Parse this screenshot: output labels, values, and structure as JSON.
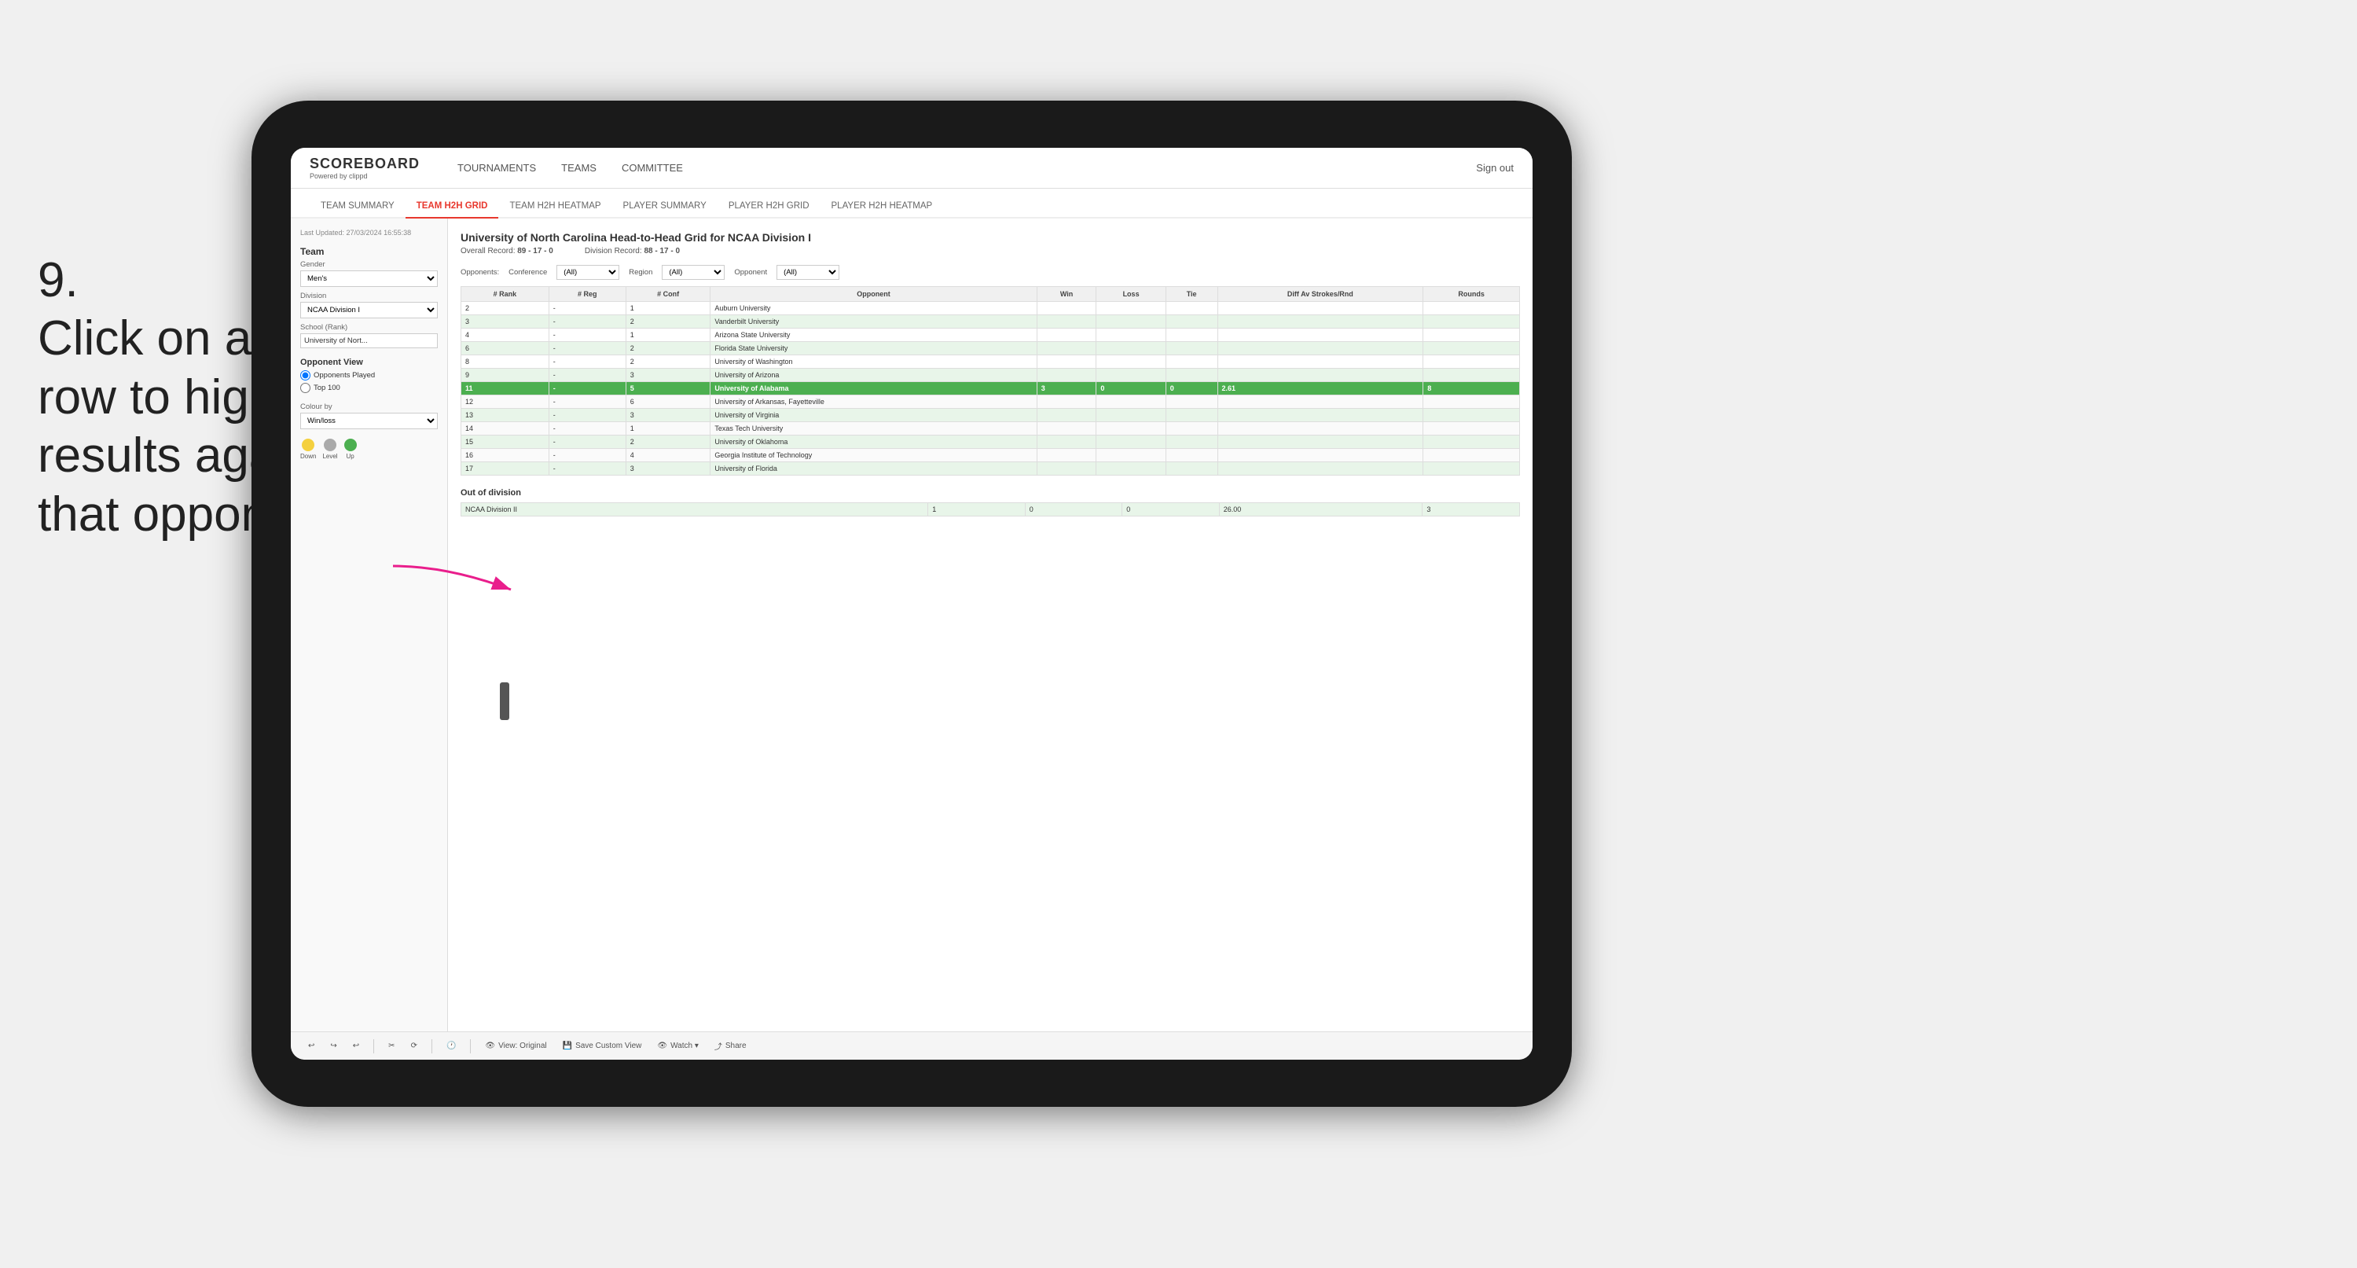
{
  "instruction": {
    "number": "9.",
    "text": "Click on a team's row to highlight results against that opponent"
  },
  "nav": {
    "logo": "SCOREBOARD",
    "logo_sub": "Powered by clippd",
    "links": [
      "TOURNAMENTS",
      "TEAMS",
      "COMMITTEE"
    ],
    "sign_out": "Sign out"
  },
  "tabs": [
    {
      "label": "TEAM SUMMARY",
      "active": false
    },
    {
      "label": "TEAM H2H GRID",
      "active": true
    },
    {
      "label": "TEAM H2H HEATMAP",
      "active": false
    },
    {
      "label": "PLAYER SUMMARY",
      "active": false
    },
    {
      "label": "PLAYER H2H GRID",
      "active": false
    },
    {
      "label": "PLAYER H2H HEATMAP",
      "active": false
    }
  ],
  "left_panel": {
    "last_updated": "Last Updated: 27/03/2024 16:55:38",
    "team_section": "Team",
    "gender_label": "Gender",
    "gender_value": "Men's",
    "division_label": "Division",
    "division_value": "NCAA Division I",
    "school_rank_label": "School (Rank)",
    "school_rank_value": "University of Nort...",
    "opponent_view_title": "Opponent View",
    "radio_1": "Opponents Played",
    "radio_2": "Top 100",
    "colour_by": "Colour by",
    "colour_value": "Win/loss",
    "dots": [
      {
        "color": "#f4d03f",
        "label": "Down"
      },
      {
        "color": "#aaa",
        "label": "Level"
      },
      {
        "color": "#4caf50",
        "label": "Up"
      }
    ]
  },
  "grid": {
    "title": "University of North Carolina Head-to-Head Grid for NCAA Division I",
    "overall_record_label": "Overall Record:",
    "overall_record_value": "89 - 17 - 0",
    "division_record_label": "Division Record:",
    "division_record_value": "88 - 17 - 0",
    "filter_opponents_label": "Opponents:",
    "filter_conf_label": "Conference",
    "filter_conf_value": "(All)",
    "filter_region_label": "Region",
    "filter_region_value": "(All)",
    "filter_opponent_label": "Opponent",
    "filter_opponent_value": "(All)",
    "table_headers": [
      "# Rank",
      "# Reg",
      "# Conf",
      "Opponent",
      "Win",
      "Loss",
      "Tie",
      "Diff Av Strokes/Rnd",
      "Rounds"
    ],
    "rows": [
      {
        "rank": "2",
        "reg": "-",
        "conf": "1",
        "opponent": "Auburn University",
        "win": "",
        "loss": "",
        "tie": "",
        "diff": "",
        "rounds": "",
        "highlight": false,
        "row_color": "none"
      },
      {
        "rank": "3",
        "reg": "-",
        "conf": "2",
        "opponent": "Vanderbilt University",
        "win": "",
        "loss": "",
        "tie": "",
        "diff": "",
        "rounds": "",
        "highlight": false,
        "row_color": "light_green"
      },
      {
        "rank": "4",
        "reg": "-",
        "conf": "1",
        "opponent": "Arizona State University",
        "win": "",
        "loss": "",
        "tie": "",
        "diff": "",
        "rounds": "",
        "highlight": false,
        "row_color": "none"
      },
      {
        "rank": "6",
        "reg": "-",
        "conf": "2",
        "opponent": "Florida State University",
        "win": "",
        "loss": "",
        "tie": "",
        "diff": "",
        "rounds": "",
        "highlight": false,
        "row_color": "light_green"
      },
      {
        "rank": "8",
        "reg": "-",
        "conf": "2",
        "opponent": "University of Washington",
        "win": "",
        "loss": "",
        "tie": "",
        "diff": "",
        "rounds": "",
        "highlight": false,
        "row_color": "none"
      },
      {
        "rank": "9",
        "reg": "-",
        "conf": "3",
        "opponent": "University of Arizona",
        "win": "",
        "loss": "",
        "tie": "",
        "diff": "",
        "rounds": "",
        "highlight": false,
        "row_color": "light_green"
      },
      {
        "rank": "11",
        "reg": "-",
        "conf": "5",
        "opponent": "University of Alabama",
        "win": "3",
        "loss": "0",
        "tie": "0",
        "diff": "2.61",
        "rounds": "8",
        "highlight": true,
        "row_color": "highlighted"
      },
      {
        "rank": "12",
        "reg": "-",
        "conf": "6",
        "opponent": "University of Arkansas, Fayetteville",
        "win": "",
        "loss": "",
        "tie": "",
        "diff": "",
        "rounds": "",
        "highlight": false,
        "row_color": "none"
      },
      {
        "rank": "13",
        "reg": "-",
        "conf": "3",
        "opponent": "University of Virginia",
        "win": "",
        "loss": "",
        "tie": "",
        "diff": "",
        "rounds": "",
        "highlight": false,
        "row_color": "light_green"
      },
      {
        "rank": "14",
        "reg": "-",
        "conf": "1",
        "opponent": "Texas Tech University",
        "win": "",
        "loss": "",
        "tie": "",
        "diff": "",
        "rounds": "",
        "highlight": false,
        "row_color": "none"
      },
      {
        "rank": "15",
        "reg": "-",
        "conf": "2",
        "opponent": "University of Oklahoma",
        "win": "",
        "loss": "",
        "tie": "",
        "diff": "",
        "rounds": "",
        "highlight": false,
        "row_color": "light_green"
      },
      {
        "rank": "16",
        "reg": "-",
        "conf": "4",
        "opponent": "Georgia Institute of Technology",
        "win": "",
        "loss": "",
        "tie": "",
        "diff": "",
        "rounds": "",
        "highlight": false,
        "row_color": "none"
      },
      {
        "rank": "17",
        "reg": "-",
        "conf": "3",
        "opponent": "University of Florida",
        "win": "",
        "loss": "",
        "tie": "",
        "diff": "",
        "rounds": "",
        "highlight": false,
        "row_color": "light_green"
      }
    ],
    "out_of_division_label": "Out of division",
    "out_of_division_rows": [
      {
        "opponent": "NCAA Division II",
        "win": "1",
        "loss": "0",
        "tie": "0",
        "diff": "26.00",
        "rounds": "3"
      }
    ]
  },
  "toolbar": {
    "undo": "↩",
    "redo": "↪",
    "view_original": "View: Original",
    "save_custom": "Save Custom View",
    "watch": "Watch ▾",
    "share": "Share"
  }
}
